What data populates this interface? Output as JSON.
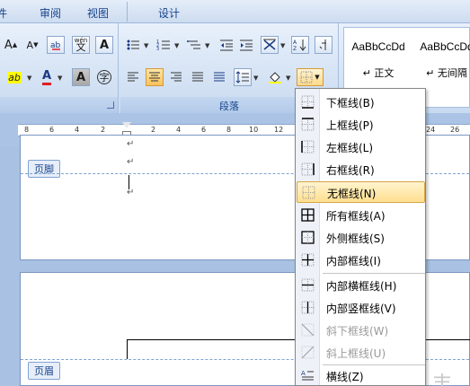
{
  "tabs": {
    "file_partial": "件",
    "review": "审阅",
    "view": "视图",
    "design": "设计"
  },
  "ribbon": {
    "font_group": {
      "grow_font": "A",
      "shrink_font": "A",
      "phonetic": "wén",
      "char_border": "A",
      "highlight": "ab",
      "font_color": "A",
      "shading": "A",
      "enclose": "字"
    },
    "paragraph_group": {
      "label": "段落"
    },
    "styles": [
      {
        "sample": "AaBbCcDd",
        "name": "↵ 正文"
      },
      {
        "sample": "AaBbCcDd",
        "name": "↵ 无间隔"
      }
    ]
  },
  "ruler": {
    "numbers": [
      "8",
      "6",
      "4",
      "2",
      "2",
      "4",
      "6",
      "8",
      "10",
      "12",
      "24",
      "26"
    ]
  },
  "document": {
    "footer_tag": "页脚",
    "header_tag": "页眉",
    "partial_char": "丰"
  },
  "border_menu": {
    "items": [
      {
        "label": "下框线(B)",
        "icon": "bottom-border-icon",
        "state": "normal"
      },
      {
        "label": "上框线(P)",
        "icon": "top-border-icon",
        "state": "normal"
      },
      {
        "label": "左框线(L)",
        "icon": "left-border-icon",
        "state": "normal"
      },
      {
        "label": "右框线(R)",
        "icon": "right-border-icon",
        "state": "normal"
      },
      {
        "label": "无框线(N)",
        "icon": "no-border-icon",
        "state": "highlighted"
      },
      {
        "label": "所有框线(A)",
        "icon": "all-borders-icon",
        "state": "normal"
      },
      {
        "label": "外侧框线(S)",
        "icon": "outside-borders-icon",
        "state": "normal"
      },
      {
        "label": "内部框线(I)",
        "icon": "inside-borders-icon",
        "state": "normal"
      },
      {
        "label": "内部横框线(H)",
        "icon": "inside-horizontal-border-icon",
        "state": "normal"
      },
      {
        "label": "内部竖框线(V)",
        "icon": "inside-vertical-border-icon",
        "state": "normal"
      },
      {
        "label": "斜下框线(W)",
        "icon": "diagonal-down-border-icon",
        "state": "disabled"
      },
      {
        "label": "斜上框线(U)",
        "icon": "diagonal-up-border-icon",
        "state": "disabled"
      },
      {
        "label": "横线(Z)",
        "icon": "horizontal-line-icon",
        "state": "normal"
      }
    ]
  },
  "colors": {
    "ribbon_text": "#15428b",
    "highlight_border": "#d8a546",
    "highlight_fill": "#ffdf8f",
    "font_color_red": "#e02020",
    "highlight_yellow": "#ffff00"
  }
}
